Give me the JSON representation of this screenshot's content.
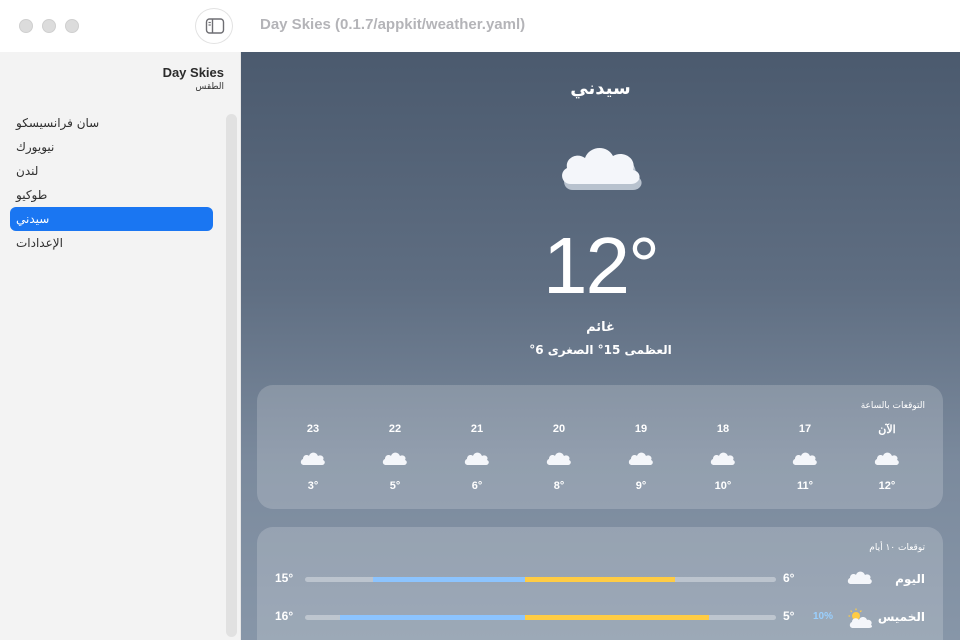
{
  "window": {
    "title": "Day Skies (0.1.7/appkit/weather.yaml)"
  },
  "sidebar": {
    "app_name": "Day Skies",
    "app_subtitle": "الطقس",
    "items": [
      {
        "label": "سان فرانسيسكو",
        "selected": false
      },
      {
        "label": "نيويورك",
        "selected": false
      },
      {
        "label": "لندن",
        "selected": false
      },
      {
        "label": "طوكيو",
        "selected": false
      },
      {
        "label": "سيدني",
        "selected": true
      },
      {
        "label": "الإعدادات",
        "selected": false
      }
    ]
  },
  "current": {
    "city": "سيدني",
    "icon": "cloud-icon",
    "temperature": "12°",
    "condition": "غائم",
    "high_low": "العظمى 15° الصغرى 6°"
  },
  "hourly": {
    "title": "التوقعات بالساعة",
    "hours": [
      {
        "label": "الآن",
        "temp": "12°",
        "icon": "cloud-icon"
      },
      {
        "label": "17",
        "temp": "11°",
        "icon": "cloud-icon"
      },
      {
        "label": "18",
        "temp": "10°",
        "icon": "cloud-icon"
      },
      {
        "label": "19",
        "temp": "9°",
        "icon": "cloud-icon"
      },
      {
        "label": "20",
        "temp": "8°",
        "icon": "cloud-icon"
      },
      {
        "label": "21",
        "temp": "6°",
        "icon": "cloud-icon"
      },
      {
        "label": "22",
        "temp": "5°",
        "icon": "cloud-icon"
      },
      {
        "label": "23",
        "temp": "3°",
        "icon": "cloud-icon"
      }
    ]
  },
  "daily": {
    "title": "توقعات ١٠ أيام",
    "days": [
      {
        "name": "اليوم",
        "icon": "cloud-icon",
        "precip": "",
        "low": "6°",
        "high": "15°"
      },
      {
        "name": "الخميس",
        "icon": "partly-cloudy-icon",
        "precip": "10%",
        "low": "5°",
        "high": "16°"
      }
    ]
  },
  "colors": {
    "accent": "#1a76f2",
    "cold_bar": "#8cc4ff",
    "warm_bar": "#ffcc44"
  }
}
